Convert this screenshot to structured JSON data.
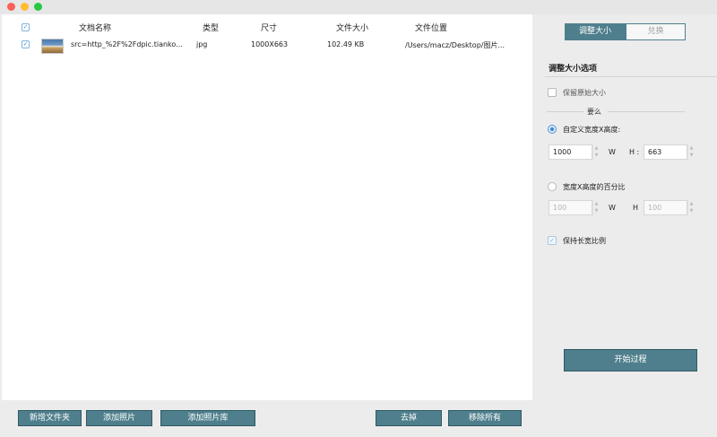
{
  "table": {
    "headers": {
      "name": "文档名称",
      "type": "类型",
      "dimensions": "尺寸",
      "size": "文件大小",
      "location": "文件位置"
    },
    "header_checkbox": "✓",
    "rows": [
      {
        "checked": "✓",
        "name": "src=http_%2F%2Fdpic.tianko...",
        "type": "jpg",
        "dimensions": "1000X663",
        "size": "102.49 KB",
        "location": "/Users/macz/Desktop/图片..."
      }
    ]
  },
  "sidebar": {
    "tabs": {
      "resize": "调整大小",
      "convert": "兑换"
    },
    "section_title": "调整大小选项",
    "keep_original_label": "保留原始大小",
    "or_text": "要么",
    "custom_label": "自定义宽度X高度:",
    "custom_width": "1000",
    "custom_height": "663",
    "w_label": "W",
    "h_label_colon": "H :",
    "percent_label": "宽度X高度的百分比",
    "percent_width": "100",
    "percent_height": "100",
    "h_label": "H",
    "keep_ratio_label": "保持长宽比例",
    "keep_ratio_check": "✓",
    "start_button": "开始过程"
  },
  "bottom_buttons": {
    "new_folder": "新增文件夹",
    "add_photo": "添加照片",
    "add_library": "添加照片库",
    "remove": "去掉",
    "remove_all": "移除所有"
  },
  "colors": {
    "accent": "#4f7f8c",
    "close": "#fe5f57",
    "minimize": "#febc2e",
    "maximize": "#28c840"
  }
}
